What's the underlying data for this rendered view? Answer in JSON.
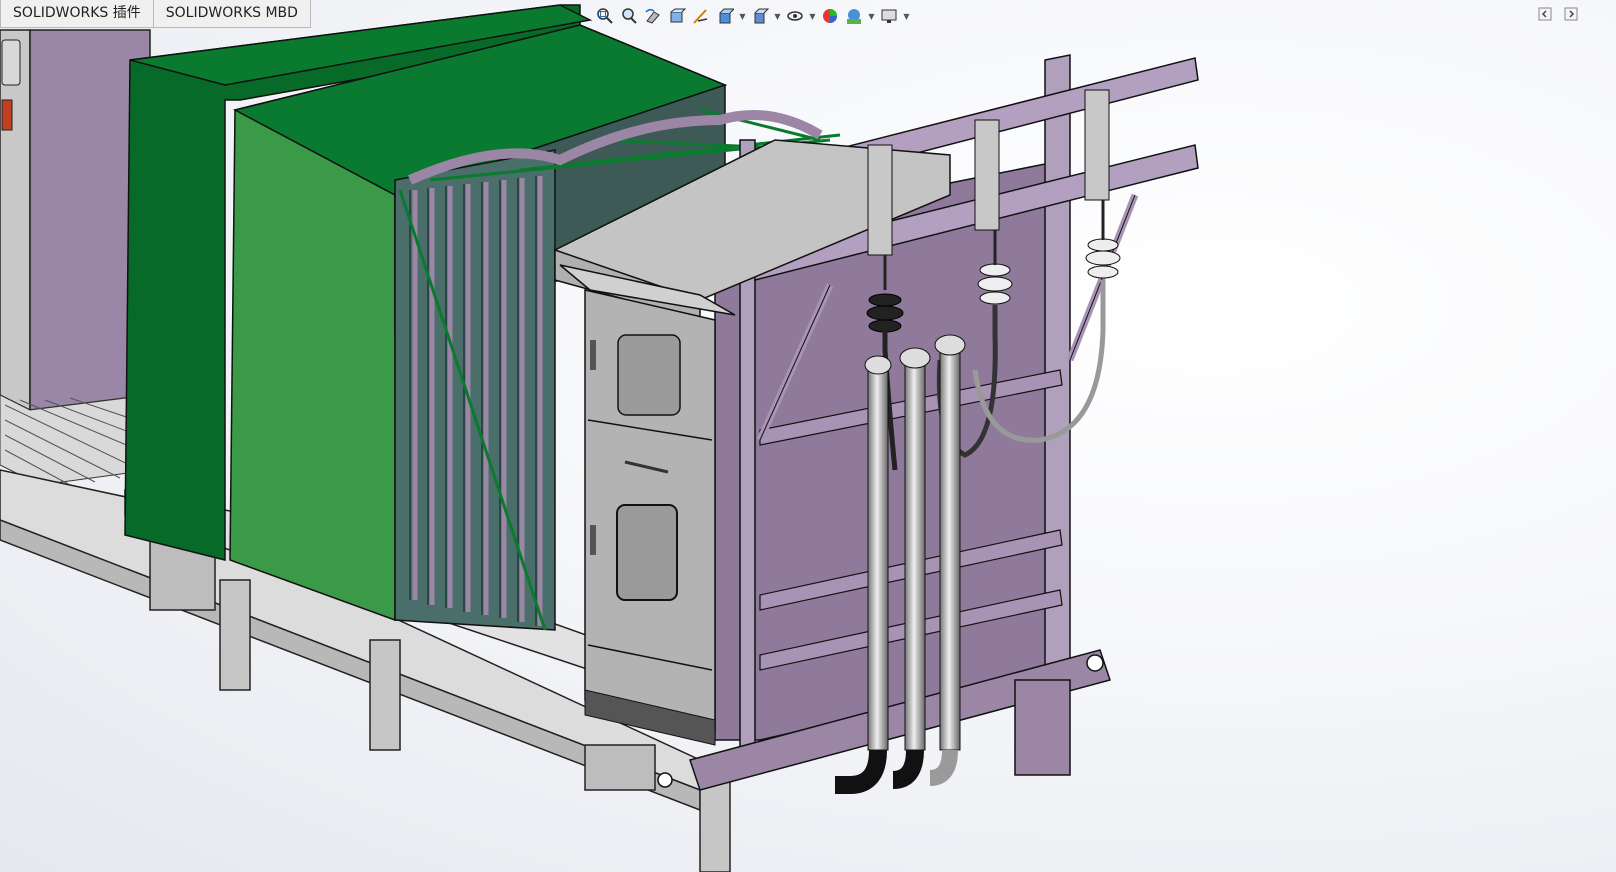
{
  "tabs": [
    {
      "label": "SOLIDWORKS 插件"
    },
    {
      "label": "SOLIDWORKS MBD"
    }
  ],
  "view_toolbar": {
    "icons": [
      "zoom-to-fit-icon",
      "zoom-to-area-icon",
      "previous-view-icon",
      "section-view-icon",
      "dynamic-annotation-icon",
      "view-orientation-icon",
      "display-style-icon",
      "hide-show-items-icon",
      "edit-appearance-icon",
      "apply-scene-icon",
      "view-settings-icon"
    ]
  },
  "panel_controls": {
    "icons": [
      "collapse-panel-icon",
      "expand-panel-icon"
    ]
  },
  "colors": {
    "frame_purple": "#9b86a6",
    "frame_gray": "#c9c9c9",
    "cabinet_dark_green": "#0b6e2b",
    "cabinet_green": "#3a9a4a",
    "radiator_teal": "#4a6f6a",
    "control_box_gray": "#b3b3b3"
  }
}
